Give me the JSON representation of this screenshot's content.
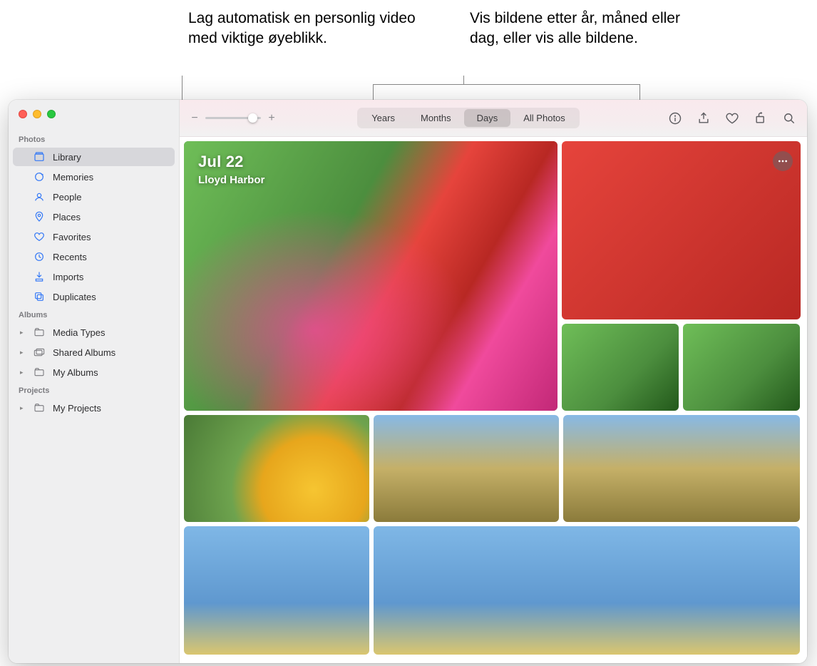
{
  "callouts": {
    "left": "Lag automatisk en personlig video med viktige øyeblikk.",
    "right": "Vis bildene etter år, måned eller dag, eller vis alle bildene."
  },
  "sidebar": {
    "sections": {
      "photos_header": "Photos",
      "albums_header": "Albums",
      "projects_header": "Projects"
    },
    "items": {
      "library": "Library",
      "memories": "Memories",
      "people": "People",
      "places": "Places",
      "favorites": "Favorites",
      "recents": "Recents",
      "imports": "Imports",
      "duplicates": "Duplicates",
      "media_types": "Media Types",
      "shared_albums": "Shared Albums",
      "my_albums": "My Albums",
      "my_projects": "My Projects"
    }
  },
  "toolbar": {
    "zoom_minus": "−",
    "zoom_plus": "+",
    "segment": {
      "years": "Years",
      "months": "Months",
      "days": "Days",
      "all": "All Photos"
    }
  },
  "hero": {
    "date": "Jul 22",
    "location": "Lloyd Harbor"
  },
  "icons": {
    "library": "library-icon",
    "memories": "memories-icon",
    "people": "people-icon",
    "places": "places-icon",
    "favorites": "favorites-icon",
    "recents": "recents-icon",
    "imports": "imports-icon",
    "duplicates": "duplicates-icon",
    "folder": "folder-icon",
    "info": "info-icon",
    "share": "share-icon",
    "heart": "heart-icon",
    "rotate": "rotate-icon",
    "search": "search-icon",
    "more": "more-icon"
  }
}
